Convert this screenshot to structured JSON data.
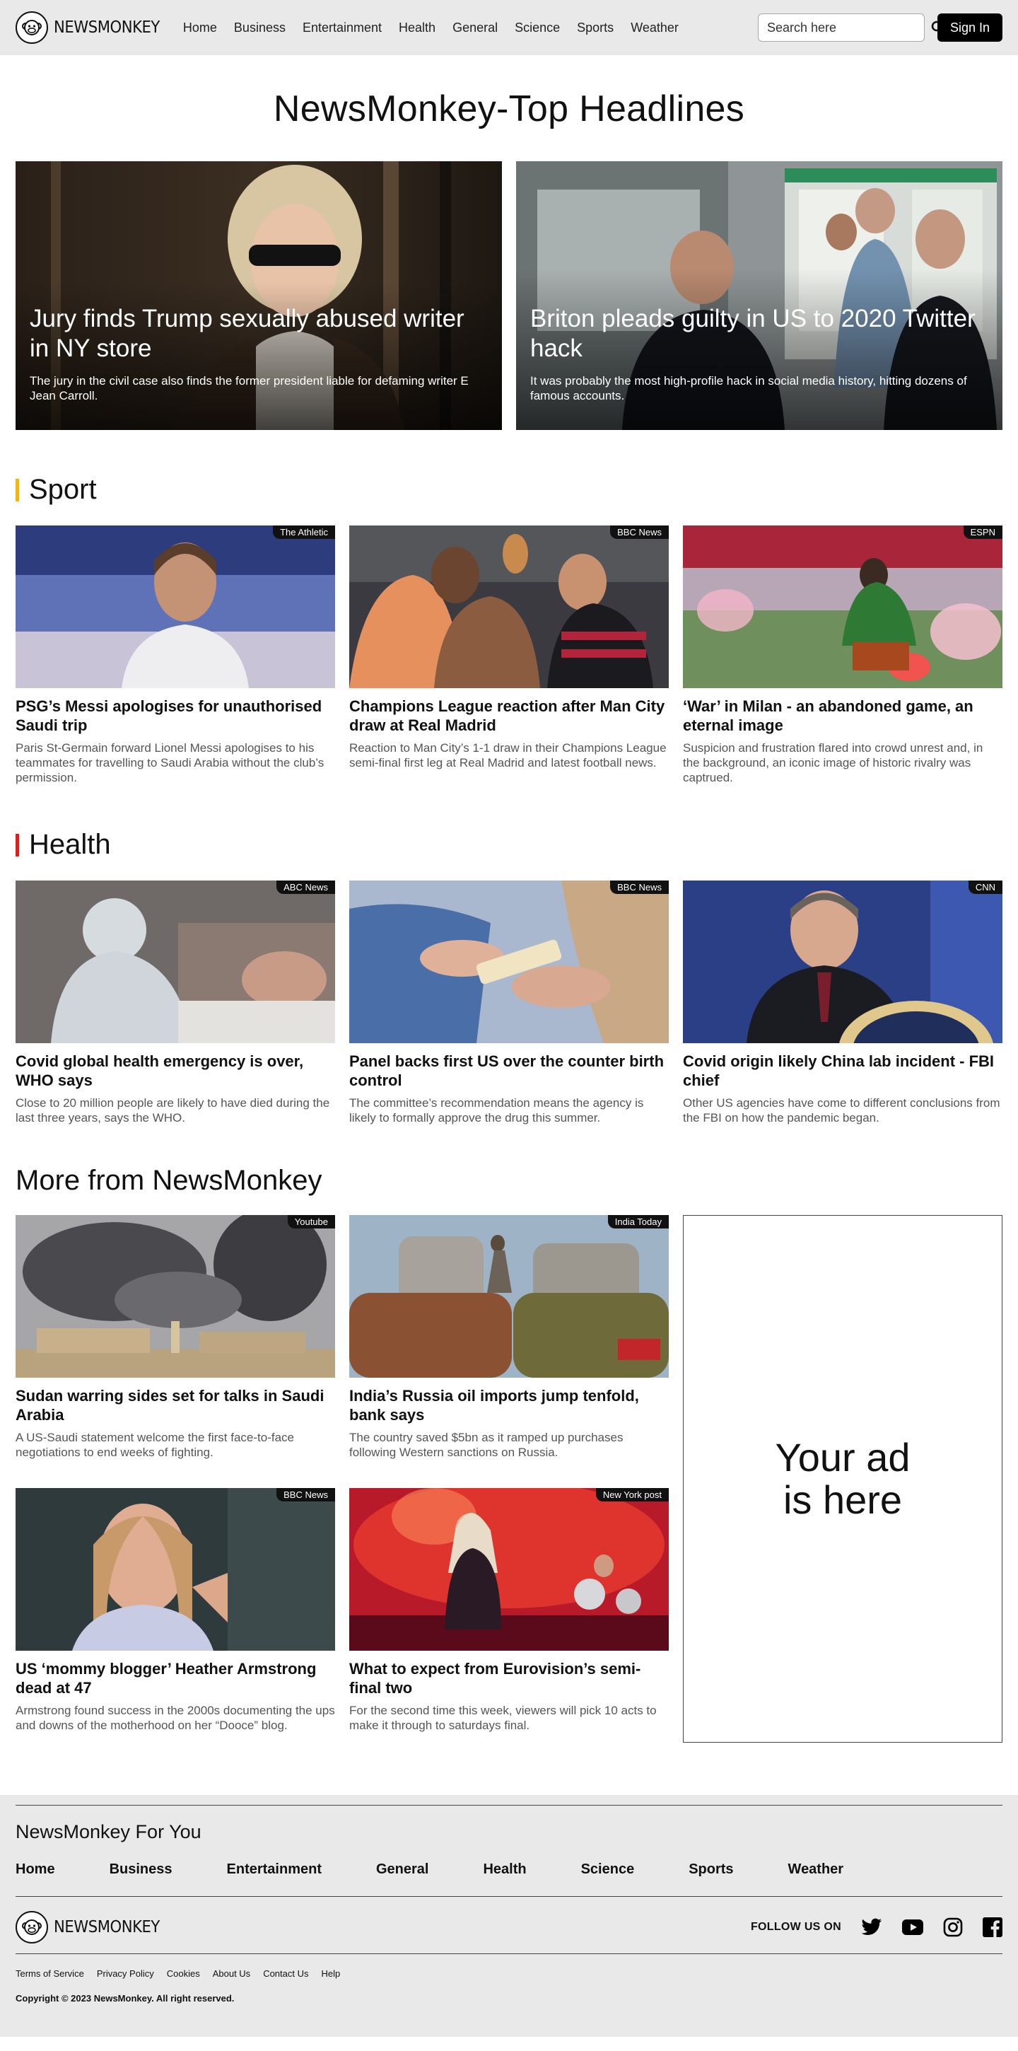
{
  "header": {
    "brand": "NEWSMONKEY",
    "nav": [
      "Home",
      "Business",
      "Entertainment",
      "Health",
      "General",
      "Science",
      "Sports",
      "Weather"
    ],
    "search_placeholder": "Search here",
    "signin_label": "Sign In"
  },
  "page_title": "NewsMonkey-Top Headlines",
  "hero": [
    {
      "title": "Jury finds Trump sexually abused writer in NY store",
      "description": "The jury in the civil case also finds the  former president liable for defaming writer E Jean Carroll."
    },
    {
      "title": "Briton pleads guilty in US to 2020 Twitter hack",
      "description": "It was probably the most high-profile hack in social media history, hitting dozens of famous accounts."
    }
  ],
  "sport": {
    "heading": "Sport",
    "accent": "#f5b800",
    "articles": [
      {
        "source": "The Athletic",
        "title": "PSG’s Messi apologises for unauthorised Saudi trip",
        "description": "Paris St-Germain forward Lionel Messi apologises to his teammates for travelling to Saudi Arabia without the club’s permission."
      },
      {
        "source": "BBC News",
        "title": "Champions League reaction after Man City draw at Real Madrid",
        "description": "Reaction to Man City’s 1-1 draw in their Champions League semi-final first leg at Real Madrid and latest football news."
      },
      {
        "source": "ESPN",
        "title": "‘War’ in Milan - an abandoned game, an eternal image",
        "description": "Suspicion and frustration flared into crowd unrest and, in the background, an iconic image of historic rivalry was captrued."
      }
    ]
  },
  "health": {
    "heading": "Health",
    "accent": "#e01b1b",
    "articles": [
      {
        "source": "ABC News",
        "title": "Covid global health emergency is over, WHO says",
        "description": "Close to 20 million people are likely to have died during the last three years, says the WHO."
      },
      {
        "source": "BBC News",
        "title": "Panel backs first US over the counter birth control",
        "description": "The committee’s recommendation means the agency is likely to formally approve the drug this summer."
      },
      {
        "source": "CNN",
        "title": "Covid origin likely China lab incident - FBI chief",
        "description": "Other US agencies have come to different conclusions from the FBI on how the pandemic began."
      }
    ]
  },
  "more": {
    "heading": "More from NewsMonkey",
    "articles": [
      {
        "source": "Youtube",
        "title": "Sudan warring sides set for talks in Saudi Arabia",
        "description": "A US-Saudi statement welcome the first face-to-face negotiations to end weeks of fighting."
      },
      {
        "source": "India Today",
        "title": "India’s Russia oil imports jump tenfold, bank says",
        "description": "The country saved $5bn as it ramped up purchases following Western sanctions on Russia."
      },
      {
        "source": "BBC News",
        "title": "US ‘mommy blogger’ Heather Armstrong dead at 47",
        "description": "Armstrong found success in the 2000s documenting the ups and downs of the motherhood on her “Dooce” blog."
      },
      {
        "source": "New York post",
        "title": "What to expect from Eurovision’s semi-final two",
        "description": "For the second time this week, viewers will pick 10 acts to make it through to saturdays final."
      }
    ],
    "ad_line1": "Your ad",
    "ad_line2": "is here"
  },
  "footer": {
    "title": "NewsMonkey For You",
    "links": [
      "Home",
      "Business",
      "Entertainment",
      "General",
      "Health",
      "Science",
      "Sports",
      "Weather"
    ],
    "brand": "NEWSMONKEY",
    "follow_label": "FOLLOW US ON",
    "social_icons": [
      "twitter-icon",
      "youtube-icon",
      "instagram-icon",
      "facebook-icon"
    ],
    "legal": [
      "Terms of Service",
      "Privacy Policy",
      "Cookies",
      "About Us",
      "Contact Us",
      "Help"
    ],
    "copyright": "Copyright © 2023 NewsMonkey. All right reserved."
  }
}
